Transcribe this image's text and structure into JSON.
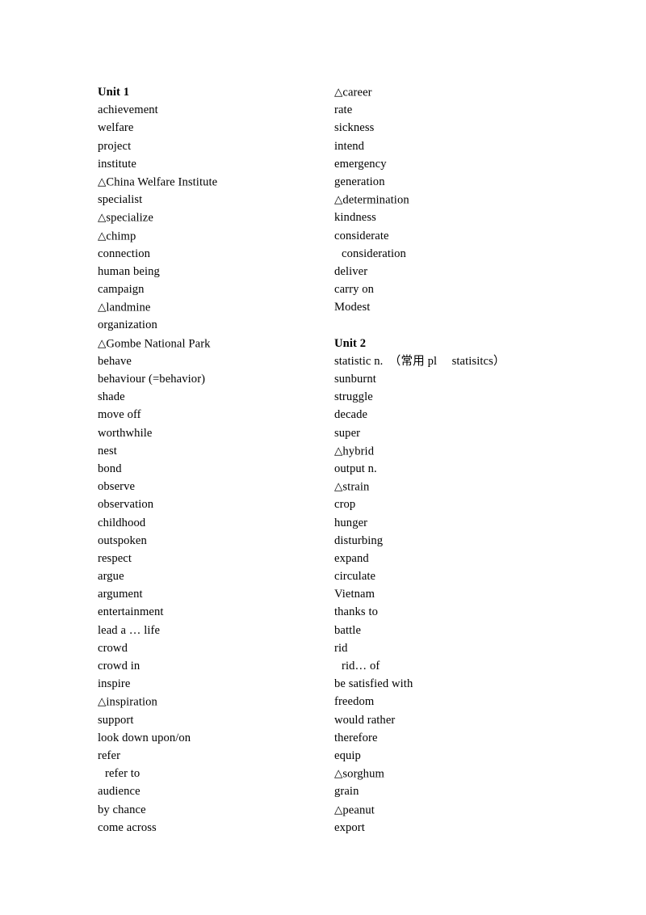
{
  "document": {
    "type": "vocabulary-word-list",
    "marker_icon": "hollow-triangle",
    "marker_glyph": "△",
    "text_color": "#000000",
    "page_color": "#ffffff"
  },
  "columns": [
    {
      "name": "left-column",
      "entries": [
        {
          "text": "Unit 1",
          "heading": true
        },
        {
          "text": "achievement"
        },
        {
          "text": "welfare"
        },
        {
          "text": "project"
        },
        {
          "text": "institute"
        },
        {
          "text": "China Welfare Institute",
          "marker": true
        },
        {
          "text": "specialist"
        },
        {
          "text": "specialize",
          "marker": true
        },
        {
          "text": "chimp",
          "marker": true
        },
        {
          "text": "connection"
        },
        {
          "text": "human being"
        },
        {
          "text": "campaign"
        },
        {
          "text": "landmine",
          "marker": true
        },
        {
          "text": "organization"
        },
        {
          "text": "Gombe National Park",
          "marker": true
        },
        {
          "text": "behave"
        },
        {
          "text": "behaviour (=behavior)"
        },
        {
          "text": "shade"
        },
        {
          "text": "move off"
        },
        {
          "text": "worthwhile"
        },
        {
          "text": "nest"
        },
        {
          "text": "bond"
        },
        {
          "text": "observe"
        },
        {
          "text": "observation"
        },
        {
          "text": "childhood"
        },
        {
          "text": "outspoken"
        },
        {
          "text": "respect"
        },
        {
          "text": "argue"
        },
        {
          "text": "argument"
        },
        {
          "text": "entertainment"
        },
        {
          "text": "lead a … life"
        },
        {
          "text": "crowd"
        },
        {
          "text": "crowd in"
        },
        {
          "text": "inspire"
        },
        {
          "text": "inspiration",
          "marker": true
        },
        {
          "text": "support"
        },
        {
          "text": "look down upon/on"
        },
        {
          "text": "refer"
        },
        {
          "text": "refer to",
          "sub": true
        },
        {
          "text": "audience"
        },
        {
          "text": "by chance"
        },
        {
          "text": "come across"
        }
      ]
    },
    {
      "name": "right-column",
      "entries": [
        {
          "text": "career",
          "marker": true
        },
        {
          "text": "rate"
        },
        {
          "text": "sickness"
        },
        {
          "text": "intend"
        },
        {
          "text": "emergency"
        },
        {
          "text": "generation"
        },
        {
          "text": "determination",
          "marker": true
        },
        {
          "text": "kindness"
        },
        {
          "text": "considerate"
        },
        {
          "text": "consideration",
          "sub": true
        },
        {
          "text": "deliver"
        },
        {
          "text": "carry on"
        },
        {
          "text": "Modest"
        },
        {
          "text": "",
          "blank": true
        },
        {
          "text": "Unit 2",
          "heading": true
        },
        {
          "text": "statistic n.　（常用 pl　 statisitcs）"
        },
        {
          "text": "sunburnt"
        },
        {
          "text": "struggle"
        },
        {
          "text": "decade"
        },
        {
          "text": "super"
        },
        {
          "text": "hybrid",
          "marker": true
        },
        {
          "text": "output n."
        },
        {
          "text": "strain",
          "marker": true
        },
        {
          "text": "crop"
        },
        {
          "text": "hunger"
        },
        {
          "text": "disturbing"
        },
        {
          "text": "expand"
        },
        {
          "text": "circulate"
        },
        {
          "text": "Vietnam"
        },
        {
          "text": "thanks to"
        },
        {
          "text": "battle"
        },
        {
          "text": "rid"
        },
        {
          "text": "rid… of",
          "sub": true
        },
        {
          "text": "be satisfied with"
        },
        {
          "text": "freedom"
        },
        {
          "text": "would rather"
        },
        {
          "text": "therefore"
        },
        {
          "text": "equip"
        },
        {
          "text": "sorghum",
          "marker": true
        },
        {
          "text": "grain"
        },
        {
          "text": "peanut",
          "marker": true
        },
        {
          "text": "export"
        }
      ]
    }
  ]
}
